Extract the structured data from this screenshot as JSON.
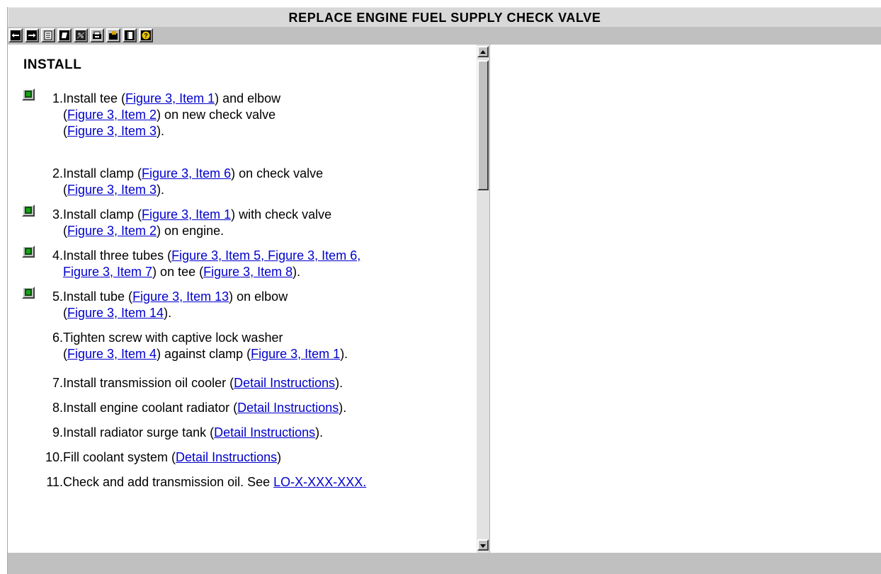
{
  "window": {
    "title": "REPLACE ENGINE FUEL SUPPLY CHECK VALVE"
  },
  "toolbar": {
    "buttons": [
      {
        "icon": "back-arrow-icon"
      },
      {
        "icon": "forward-arrow-icon"
      },
      {
        "icon": "page-icon"
      },
      {
        "icon": "bookmark-icon"
      },
      {
        "icon": "image-icon"
      },
      {
        "icon": "print-icon"
      },
      {
        "icon": "folder-icon"
      },
      {
        "icon": "book-icon"
      },
      {
        "icon": "help-icon"
      }
    ]
  },
  "section": {
    "heading": "INSTALL"
  },
  "steps": [
    {
      "num": "1.",
      "has_multimedia": true,
      "parts": [
        "Install tee (",
        {
          "link": "Figure 3, Item 1"
        },
        ") and elbow",
        {
          "br": true
        },
        "(",
        {
          "link": "Figure 3, Item 2"
        },
        ") on new check valve",
        {
          "br": true
        },
        "(",
        {
          "link": "Figure 3, Item 3"
        },
        ")."
      ]
    },
    {
      "num": "2.",
      "has_multimedia": false,
      "parts": [
        "Install clamp (",
        {
          "link": "Figure 3, Item 6"
        },
        ") on check valve",
        {
          "br": true
        },
        "(",
        {
          "link": "Figure 3, Item 3"
        },
        ")."
      ]
    },
    {
      "num": "3.",
      "has_multimedia": true,
      "parts": [
        "Install clamp (",
        {
          "link": "Figure 3, Item 1"
        },
        ") with check valve",
        {
          "br": true
        },
        "(",
        {
          "link": "Figure 3, Item 2"
        },
        ") on engine."
      ]
    },
    {
      "num": "4.",
      "has_multimedia": true,
      "parts": [
        "Install three tubes (",
        {
          "link": "Figure 3, Item 5, Figure 3, Item 6,"
        },
        {
          "br": true
        },
        {
          "link": "Figure 3, Item 7"
        },
        ") on tee (",
        {
          "link": "Figure 3, Item 8"
        },
        ")."
      ]
    },
    {
      "num": "5.",
      "has_multimedia": true,
      "parts": [
        "Install tube (",
        {
          "link": "Figure 3, Item 13"
        },
        ") on elbow",
        {
          "br": true
        },
        "(",
        {
          "link": "Figure 3, Item 14"
        },
        ")."
      ]
    },
    {
      "num": "6.",
      "has_multimedia": false,
      "parts": [
        "Tighten screw with captive lock washer",
        {
          "br": true
        },
        "(",
        {
          "link": "Figure 3, Item 4"
        },
        ") against clamp (",
        {
          "link": "Figure 3, Item 1"
        },
        ")."
      ]
    },
    {
      "num": "7.",
      "has_multimedia": false,
      "parts": [
        "Install transmission oil cooler (",
        {
          "link": "Detail Instructions"
        },
        ")."
      ]
    },
    {
      "num": "8.",
      "has_multimedia": false,
      "parts": [
        "Install engine coolant radiator (",
        {
          "link": "Detail Instructions"
        },
        ")."
      ]
    },
    {
      "num": "9.",
      "has_multimedia": false,
      "parts": [
        "Install radiator surge tank (",
        {
          "link": "Detail Instructions"
        },
        ")."
      ]
    },
    {
      "num": "10.",
      "has_multimedia": false,
      "parts": [
        "Fill coolant system (",
        {
          "link": "Detail Instructions"
        },
        ")"
      ]
    },
    {
      "num": "11.",
      "has_multimedia": false,
      "parts": [
        "Check and add transmission oil. See ",
        {
          "link": "LO-X-XXX-XXX."
        }
      ]
    }
  ],
  "colors": {
    "link": "#0000cc",
    "title_bar": "#d8d8d8",
    "toolbar": "#c0c0c0",
    "multimedia_icon": "#16a416"
  }
}
